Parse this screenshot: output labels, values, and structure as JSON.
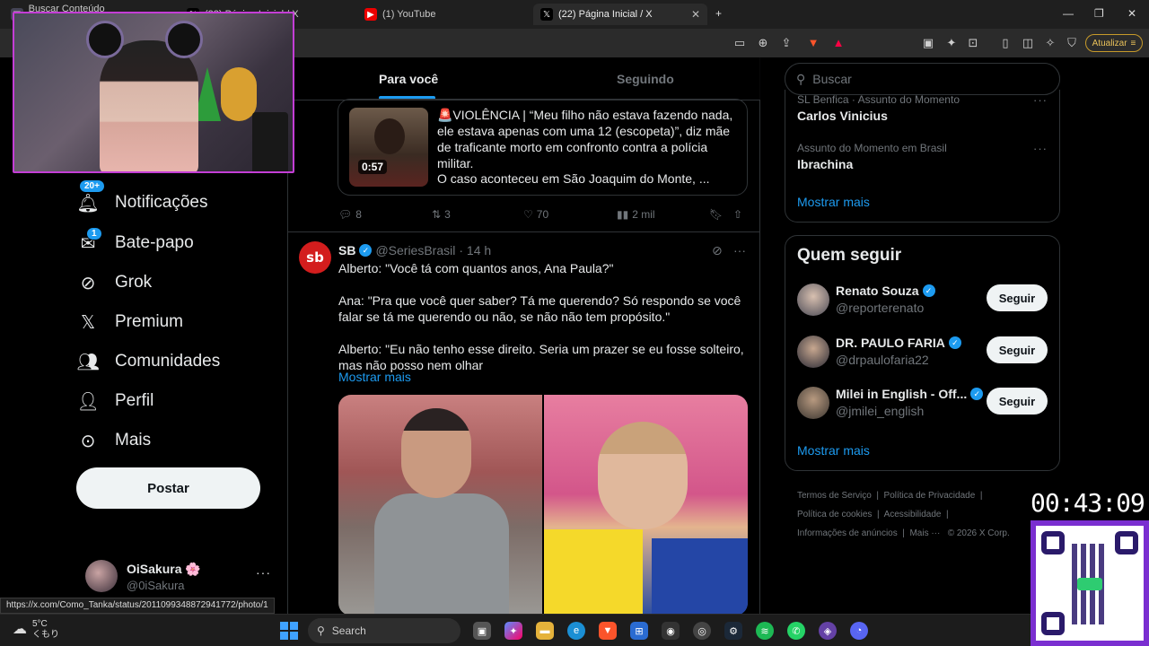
{
  "browser": {
    "tabs": [
      {
        "label": "Buscar Conteúdo RedeGospel...",
        "icon": "page-icon"
      },
      {
        "label": "(22) Página Inicial / X",
        "icon": "x-icon"
      },
      {
        "label": "(1) YouTube",
        "icon": "youtube-icon"
      },
      {
        "label": "(22) Página Inicial / X",
        "icon": "x-icon"
      }
    ],
    "new_tab": "+",
    "update_label": "Atualizar",
    "status_url": "https://x.com/Como_Tanka/status/2011099348872941772/photo/1"
  },
  "sidebar": {
    "items": [
      {
        "label": "Notificações",
        "badge": "20+",
        "icon": "bell-icon"
      },
      {
        "label": "Bate-papo",
        "badge": "1",
        "icon": "mail-icon"
      },
      {
        "label": "Grok",
        "icon": "grok-icon"
      },
      {
        "label": "Premium",
        "icon": "x-logo-icon"
      },
      {
        "label": "Comunidades",
        "icon": "people-icon"
      },
      {
        "label": "Perfil",
        "icon": "person-icon"
      },
      {
        "label": "Mais",
        "icon": "more-circle-icon"
      }
    ],
    "post_label": "Postar",
    "profile": {
      "name": "OiSakura 🌸",
      "handle": "@0iSakura",
      "more": "···"
    }
  },
  "main": {
    "tabs": [
      "Para você",
      "Seguindo"
    ],
    "card": {
      "duration": "0:57",
      "text": "🚨VIOLÊNCIA | “Meu filho não estava fazendo nada, ele estava apenas com uma 12 (escopeta)”, diz mãe de traficante morto em confronto contra a polícia militar.",
      "subtext": "O caso aconteceu em São Joaquim do Monte, ..."
    },
    "actions": {
      "replies": "8",
      "reposts": "3",
      "likes": "70",
      "views": "2 mil"
    },
    "tweet": {
      "avatar_text": "sb",
      "name": "SB",
      "handle": "@SeriesBrasil",
      "time": "· 14 h",
      "paragraphs": [
        "Alberto: \"Você tá com quantos anos, Ana Paula?\"",
        "Ana: \"Pra que você quer saber? Tá me querendo? Só respondo se você falar se tá me querendo ou não, se não não tem propósito.\"",
        "Alberto: \"Eu não tenho esse direito. Seria um prazer se eu fosse solteiro, mas não posso nem olhar"
      ],
      "show_more": "Mostrar mais"
    }
  },
  "right": {
    "search_placeholder": "Buscar",
    "trends": [
      {
        "meta": "SL Benfica · Assunto do Momento",
        "name": "Carlos Vinicius"
      },
      {
        "meta": "Assunto do Momento em Brasil",
        "name": "Ibrachina"
      }
    ],
    "trends_more": "Mostrar mais",
    "who_title": "Quem seguir",
    "who": [
      {
        "name": "Renato Souza",
        "handle": "@reporterenato",
        "button": "Seguir"
      },
      {
        "name": "DR. PAULO FARIA",
        "handle": "@drpaulofaria22",
        "button": "Seguir"
      },
      {
        "name": "Milei in English - Off...",
        "handle": "@jmilei_english",
        "button": "Seguir"
      }
    ],
    "who_more": "Mostrar mais",
    "footer": {
      "line1": [
        "Termos de Serviço",
        "Política de Privacidade"
      ],
      "line2": [
        "Política de cookies",
        "Acessibilidade"
      ],
      "line3": [
        "Informações de anúncios",
        "Mais ···",
        "© 2026 X Corp."
      ]
    }
  },
  "overlay": {
    "timer": "00:43:09"
  },
  "taskbar": {
    "temperature": "5°C",
    "condition": "くもり",
    "search_label": "Search"
  }
}
